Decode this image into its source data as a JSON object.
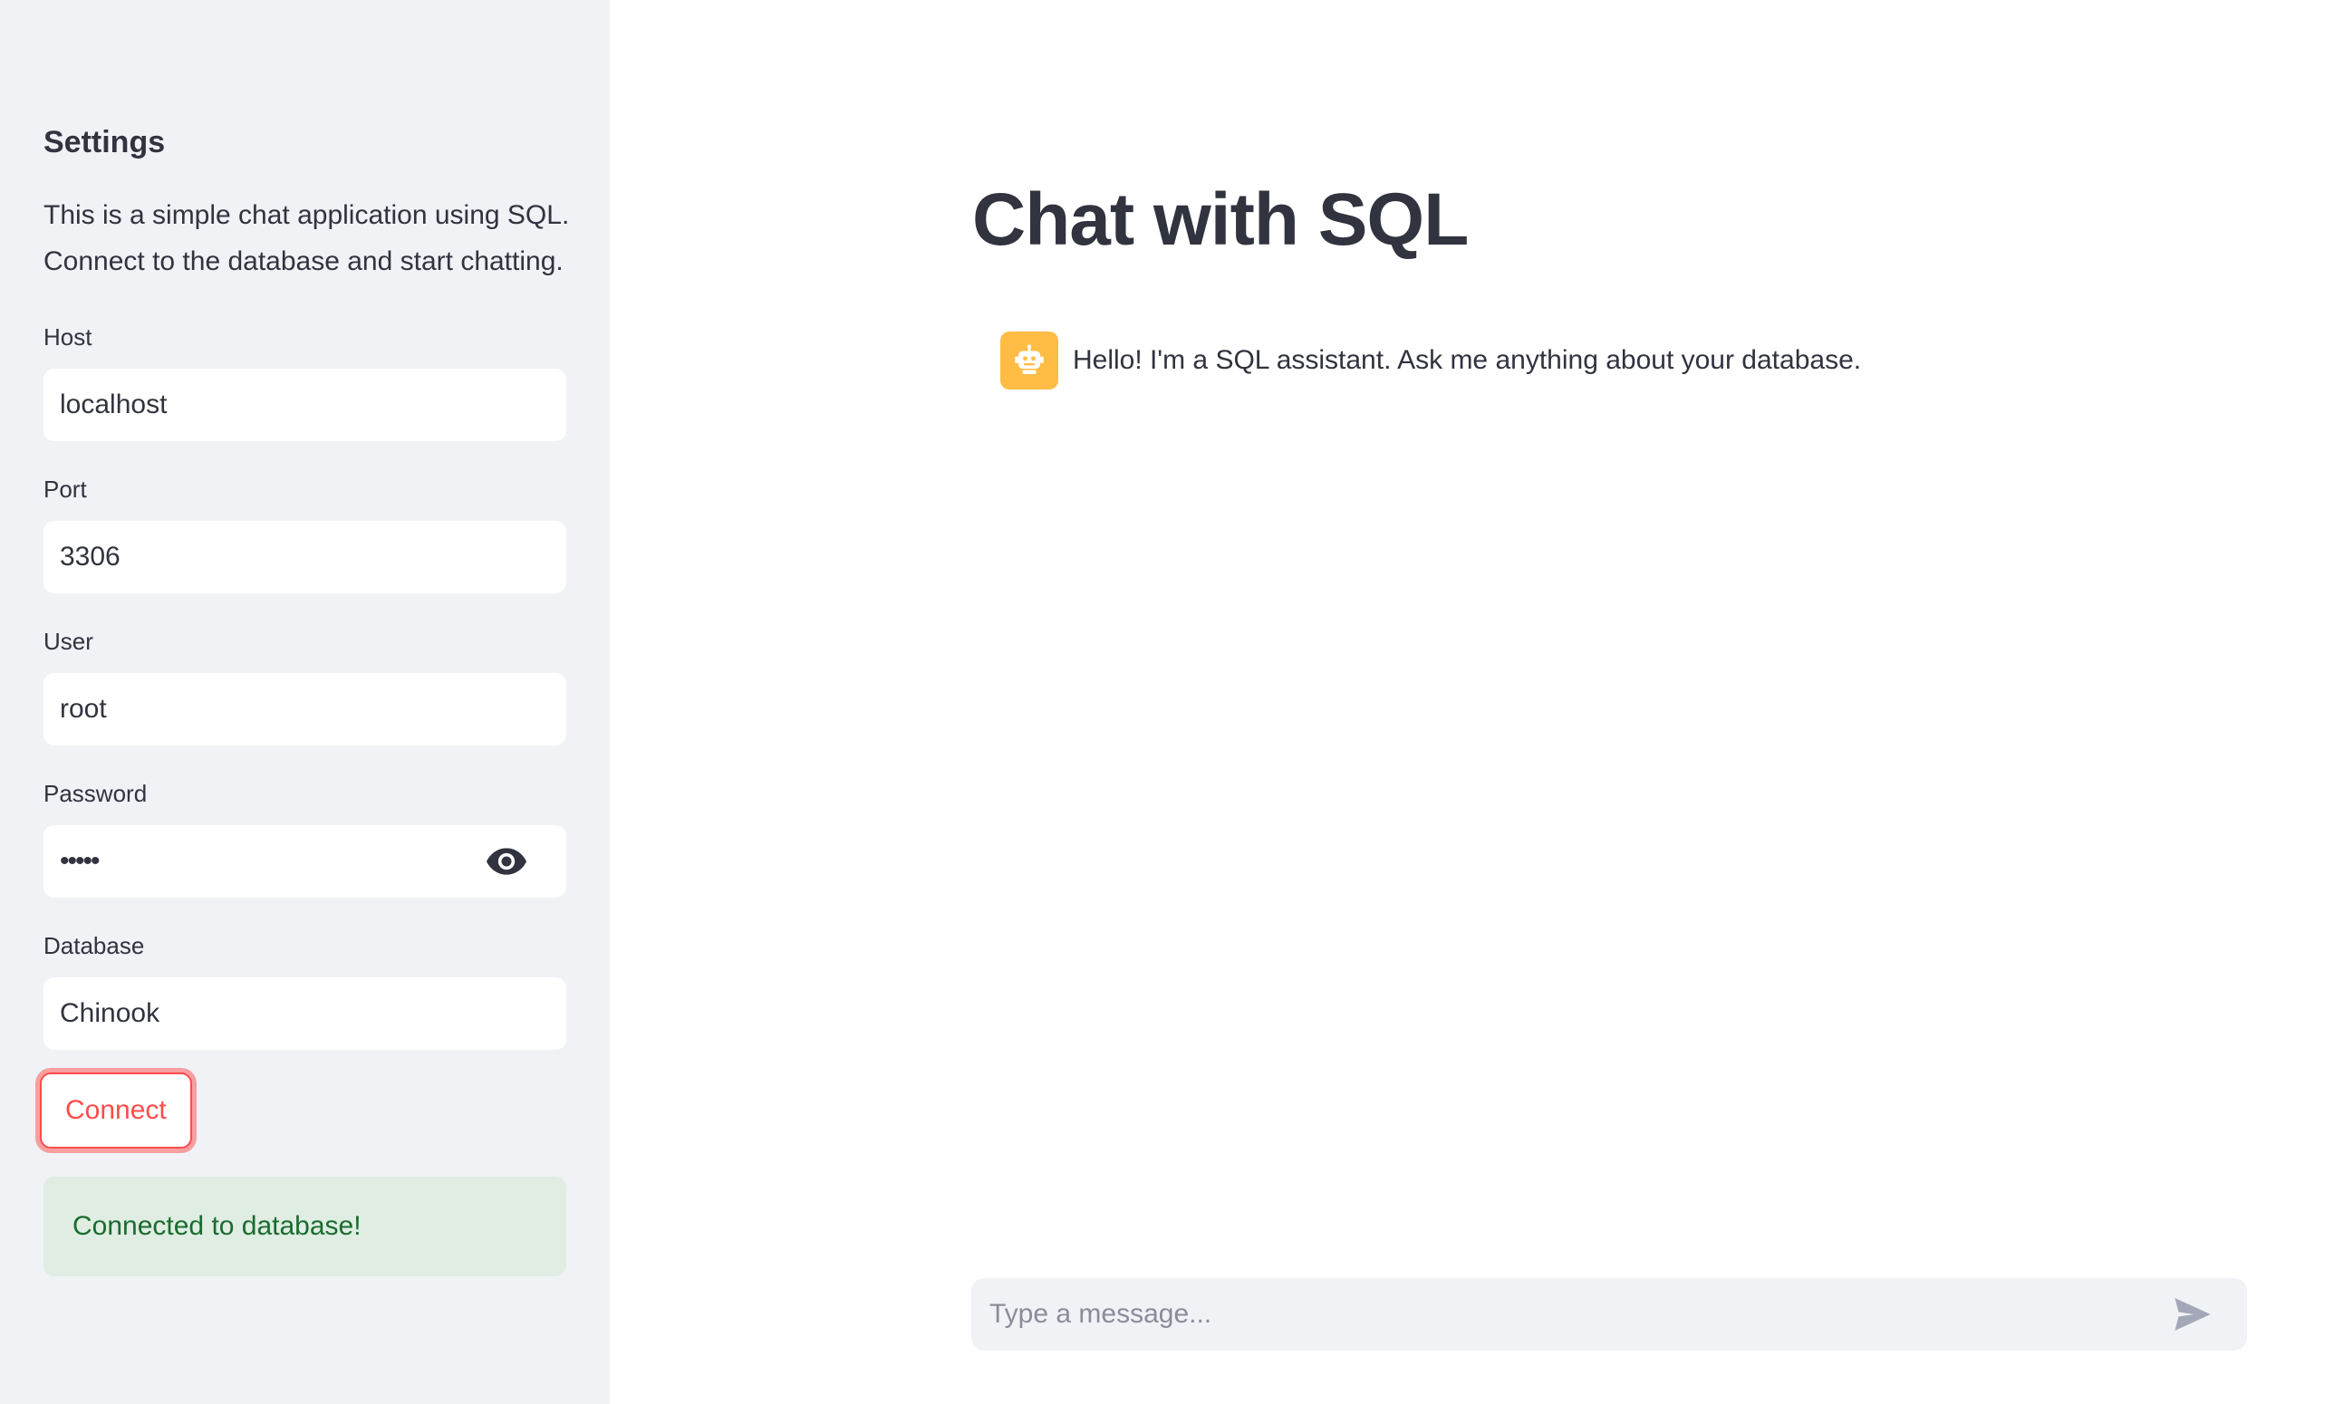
{
  "sidebar": {
    "title": "Settings",
    "description": "This is a simple chat application using SQL. Connect to the database and start chatting.",
    "fields": [
      {
        "label": "Host",
        "value": "localhost"
      },
      {
        "label": "Port",
        "value": "3306"
      },
      {
        "label": "User",
        "value": "root"
      },
      {
        "label": "Password",
        "value": "•••••"
      },
      {
        "label": "Database",
        "value": "Chinook"
      }
    ],
    "connect_label": "Connect",
    "status_message": "Connected to database!"
  },
  "main": {
    "title": "Chat with SQL",
    "messages": [
      {
        "role": "assistant",
        "avatar_icon": "robot-icon",
        "text": "Hello! I'm a SQL assistant. Ask me anything about your database."
      }
    ],
    "chat_input": {
      "placeholder": "Type a message...",
      "send_icon": "send-icon"
    }
  },
  "colors": {
    "sidebar_bg": "#f0f2f6",
    "accent": "#ff4b4b",
    "success_bg": "#dfede3",
    "success_text": "#1a6b2e",
    "avatar_bg": "#ffbd45"
  }
}
